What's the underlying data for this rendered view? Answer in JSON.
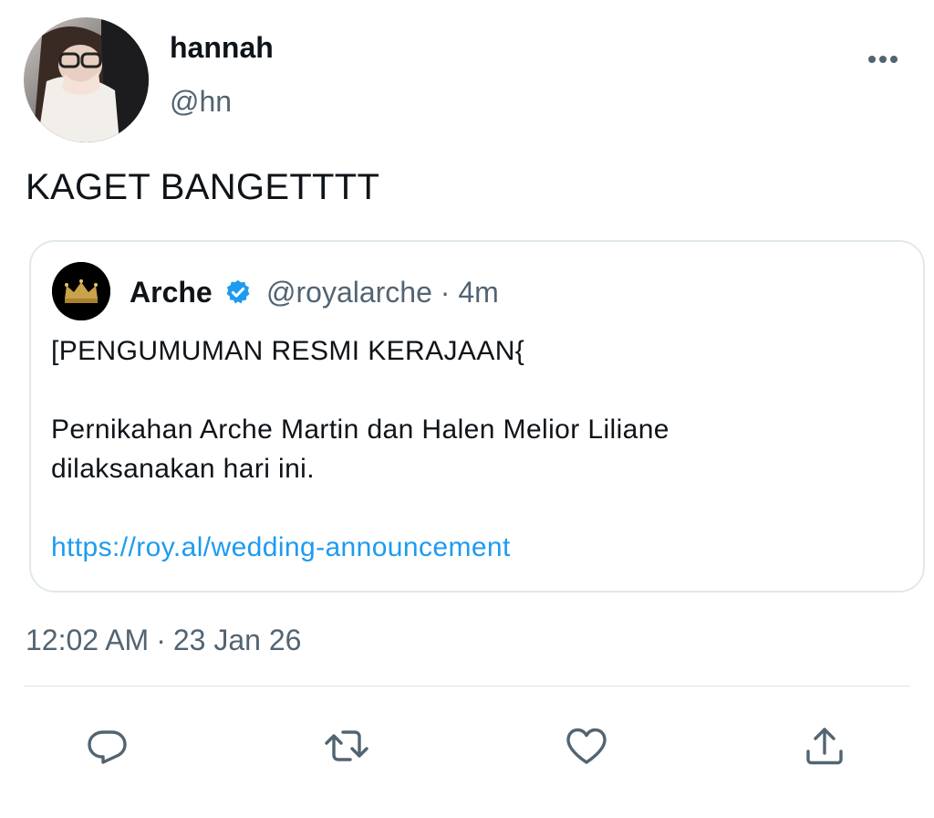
{
  "tweet": {
    "author": {
      "name": "hannah",
      "handle": "@hn"
    },
    "text": "KAGET BANGETTTT",
    "timestamp": {
      "time": "12:02 AM",
      "separator": "·",
      "date": "23 Jan 26"
    },
    "more_icon": "more-horizontal-icon"
  },
  "quote": {
    "author": {
      "name": "Arche",
      "handle": "@royalarche",
      "separator": "·",
      "time_ago": "4m",
      "verified": true,
      "avatar_icon": "crown-icon"
    },
    "lines": [
      "[PENGUMUMAN RESMI KERAJAAN{",
      "Pernikahan Arche Martin dan Halen Melior Liliane",
      "dilaksanakan hari ini."
    ],
    "link": "https://roy.al/wedding-announcement"
  },
  "actions": [
    {
      "icon": "reply-icon"
    },
    {
      "icon": "retweet-icon"
    },
    {
      "icon": "like-icon"
    },
    {
      "icon": "share-icon"
    }
  ],
  "colors": {
    "text": "#0f1419",
    "secondary": "#536471",
    "link": "#1d9bf0",
    "verified": "#1d9bf0",
    "border": "#e1e8ed"
  }
}
